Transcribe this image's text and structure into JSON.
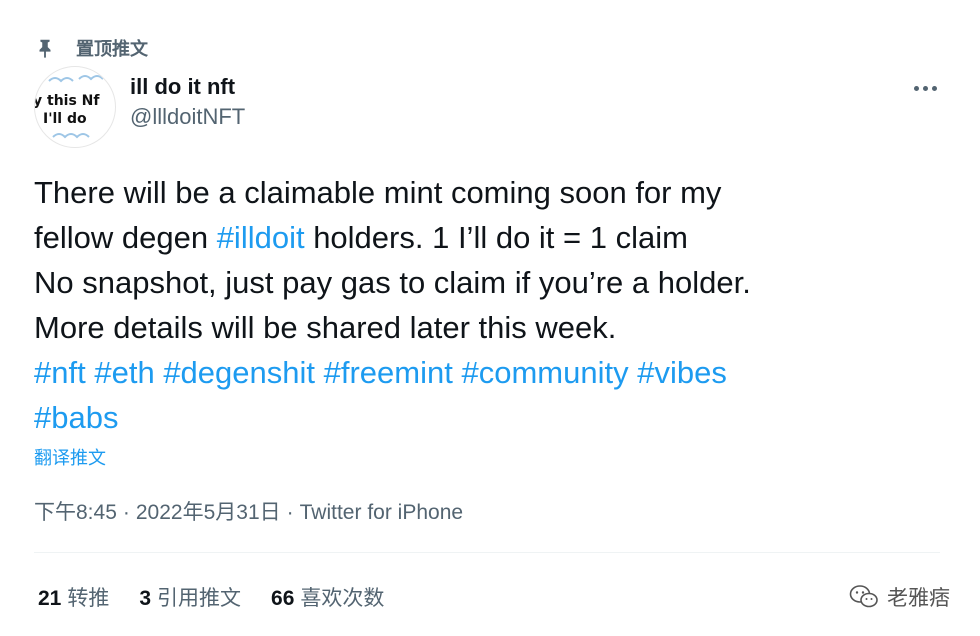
{
  "pinned": {
    "icon": "pin-icon",
    "label": "置顶推文"
  },
  "author": {
    "avatar_text_line1": "y this Nf",
    "avatar_text_line2": "I'll do",
    "name": "ill do it nft",
    "handle": "@llldoitNFT"
  },
  "more_icon": "more-horizontal-icon",
  "tweet": {
    "line1": "There will be a claimable mint coming soon for my",
    "line2_prefix": "fellow degen ",
    "line2_hashtag": "#illdoit",
    "line2_suffix": " holders. 1 I’ll do it = 1 claim",
    "line3": "No snapshot, just pay gas to claim if you’re a holder.",
    "line4": "More details will be shared later this week.",
    "hashtags": [
      "#nft",
      "#eth",
      "#degenshit",
      "#freemint",
      "#community",
      "#vibes",
      "#babs"
    ]
  },
  "translate_label": "翻译推文",
  "meta": {
    "time": "下午8:45",
    "separator": "·",
    "date": "2022年5月31日",
    "source": "Twitter for iPhone"
  },
  "stats": {
    "retweets_count": "21",
    "retweets_label": "转推",
    "quotes_count": "3",
    "quotes_label": "引用推文",
    "likes_count": "66",
    "likes_label": "喜欢次数"
  },
  "watermark": {
    "icon": "wechat-icon",
    "text": "老雅痞"
  },
  "colors": {
    "link": "#1d9bf0",
    "secondary_text": "#536471",
    "primary_text": "#0f1419",
    "divider": "#eff3f4"
  }
}
